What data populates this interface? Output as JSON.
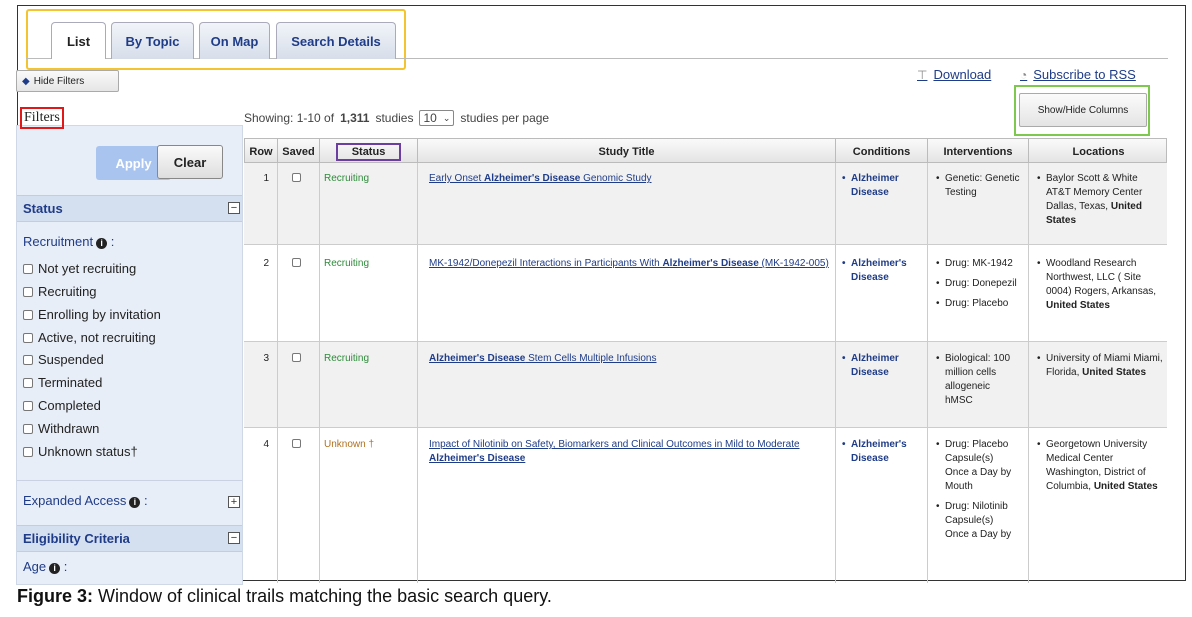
{
  "tabs": [
    {
      "label": "List",
      "active": true
    },
    {
      "label": "By Topic",
      "active": false
    },
    {
      "label": "On Map",
      "active": false
    },
    {
      "label": "Search Details",
      "active": false
    }
  ],
  "toolbar": {
    "hide_filters": "Hide Filters",
    "download": "Download",
    "rss": "Subscribe to RSS",
    "show_hide_columns": "Show/Hide Columns"
  },
  "filters": {
    "title": "Filters",
    "apply": "Apply",
    "clear": "Clear",
    "status_section": "Status",
    "recruitment_label": "Recruitment",
    "recruitment_colon": ":",
    "options": [
      "Not yet recruiting",
      "Recruiting",
      "Enrolling by invitation",
      "Active, not recruiting",
      "Suspended",
      "Terminated",
      "Completed",
      "Withdrawn",
      "Unknown status†"
    ],
    "expanded_access": "Expanded Access",
    "expanded_access_colon": ":",
    "eligibility_section": "Eligibility Criteria",
    "age_label": "Age",
    "age_colon": ":"
  },
  "results": {
    "showing_prefix": "Showing: 1-10 of",
    "total": "1,311",
    "showing_suffix": "studies",
    "per_page_value": "10",
    "per_page_suffix": "studies per page"
  },
  "table": {
    "headers": [
      "Row",
      "Saved",
      "Status",
      "Study Title",
      "Conditions",
      "Interventions",
      "Locations"
    ],
    "rows": [
      {
        "row": "1",
        "status": "Recruiting",
        "title_pre": "Early Onset ",
        "title_bold": "Alzheimer's Disease",
        "title_post": " Genomic Study",
        "condition_1": "Alzheimer",
        "condition_2": "Disease",
        "interventions": [
          "Genetic: Genetic Testing"
        ],
        "location_text": "Baylor Scott & White AT&T Memory Center Dallas, Texas, ",
        "location_bold": "United States"
      },
      {
        "row": "2",
        "status": "Recruiting",
        "title_pre": "MK-1942/Donepezil Interactions in Participants With ",
        "title_bold": "Alzheimer's Disease",
        "title_post": " (MK-1942-005)",
        "condition_1": "Alzheimer's",
        "condition_2": "Disease",
        "interventions": [
          "Drug: MK-1942",
          "Drug: Donepezil",
          "Drug: Placebo"
        ],
        "location_text": "Woodland Research Northwest, LLC ( Site 0004) Rogers, Arkansas, ",
        "location_bold": "United States"
      },
      {
        "row": "3",
        "status": "Recruiting",
        "title_pre": "",
        "title_bold": "Alzheimer's Disease",
        "title_post": " Stem Cells Multiple Infusions",
        "condition_1": "Alzheimer",
        "condition_2": "Disease",
        "interventions": [
          "Biological: 100 million cells allogeneic hMSC"
        ],
        "location_text": "University of Miami Miami, Florida, ",
        "location_bold": "United States"
      },
      {
        "row": "4",
        "status": "Unknown †",
        "title_pre": "Impact of Nilotinib on Safety, Biomarkers and Clinical Outcomes in Mild to Moderate ",
        "title_bold": "Alzheimer's Disease",
        "title_post": "",
        "condition_1": "Alzheimer's",
        "condition_2": "Disease",
        "interventions": [
          "Drug: Placebo Capsule(s) Once a Day by Mouth",
          "Drug: Nilotinib Capsule(s) Once a Day by"
        ],
        "location_text": "Georgetown University Medical Center Washington, District of Columbia, ",
        "location_bold": "United States"
      }
    ]
  },
  "caption": {
    "label": "Figure 3:",
    "text": " Window of clinical trails matching the basic search query."
  },
  "colors": {
    "tab_highlight": "#f4c430",
    "filters_highlight": "#e0181a",
    "status_highlight": "#6b3fa0",
    "columns_highlight": "#7ec850",
    "link": "#1f3c88",
    "recruiting": "#2e8b3a"
  }
}
